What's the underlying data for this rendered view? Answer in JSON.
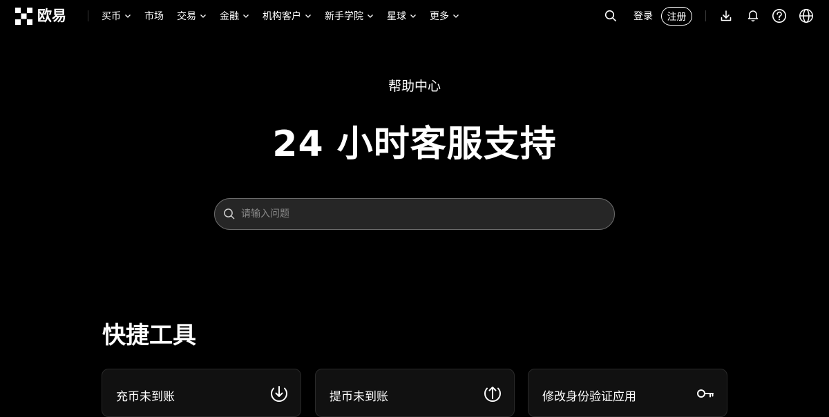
{
  "header": {
    "brand": "欧易",
    "nav": [
      {
        "label": "买币",
        "has_dropdown": true
      },
      {
        "label": "市场",
        "has_dropdown": false
      },
      {
        "label": "交易",
        "has_dropdown": true
      },
      {
        "label": "金融",
        "has_dropdown": true
      },
      {
        "label": "机构客户",
        "has_dropdown": true
      },
      {
        "label": "新手学院",
        "has_dropdown": true
      },
      {
        "label": "星球",
        "has_dropdown": true
      },
      {
        "label": "更多",
        "has_dropdown": true
      }
    ],
    "login_label": "登录",
    "register_label": "注册",
    "icons": [
      "search-icon",
      "download-icon",
      "bell-icon",
      "help-icon",
      "globe-icon"
    ]
  },
  "hero": {
    "subtitle": "帮助中心",
    "title": "24 小时客服支持",
    "search": {
      "placeholder": "请输入问题",
      "value": ""
    }
  },
  "quick_tools": {
    "title": "快捷工具",
    "cards": [
      {
        "label": "充币未到账",
        "icon": "deposit-arrow-down-icon"
      },
      {
        "label": "提币未到账",
        "icon": "withdraw-arrow-up-icon"
      },
      {
        "label": "修改身份验证应用",
        "icon": "key-icon"
      }
    ]
  },
  "colors": {
    "background": "#000000",
    "text": "#ffffff",
    "search_bg": "#262626",
    "card_bg": "#111111"
  }
}
